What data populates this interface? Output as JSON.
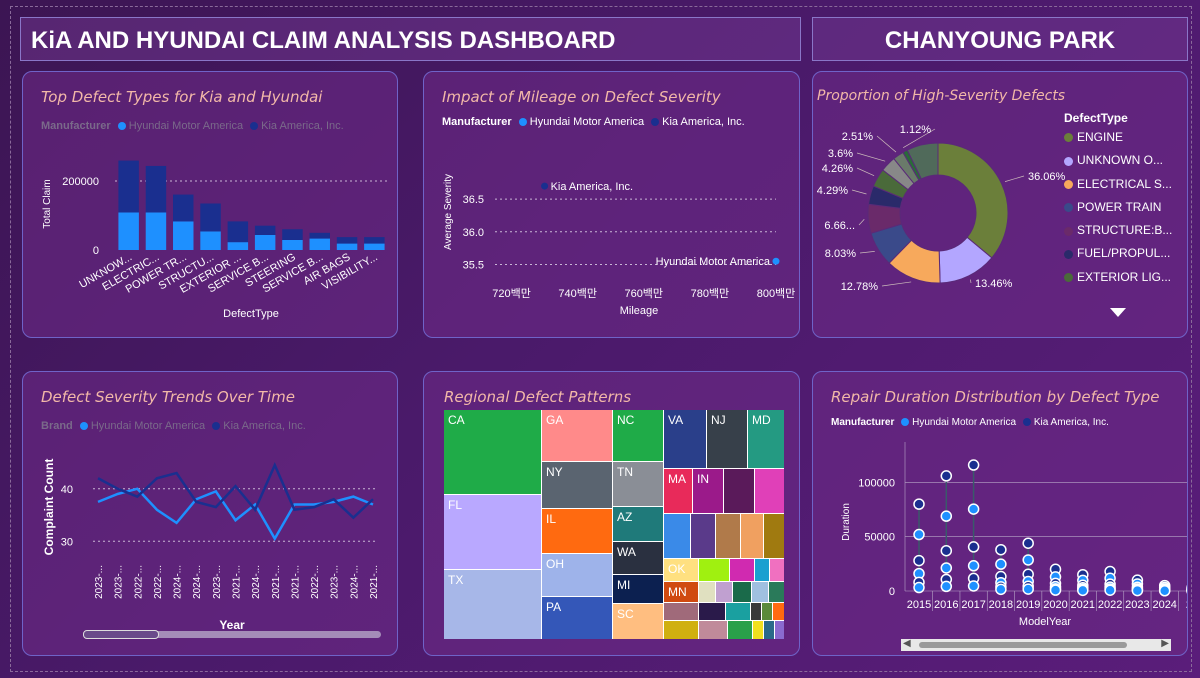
{
  "header": {
    "title": "KiA AND HYUNDAI CLAIM ANALYSIS DASHBOARD",
    "author": "CHANYOUNG PARK"
  },
  "colors": {
    "hyundai": "#1e90ff",
    "kia": "#1a2f8f",
    "title": "#f2b8a8"
  },
  "legend": {
    "manufacturer": "Manufacturer",
    "brand": "Brand",
    "hyundai": "Hyundai Motor America",
    "kia": "Kia America, Inc."
  },
  "charts": [
    {
      "id": "top-defect-types",
      "title": "Top Defect Types for Kia and Hyundai",
      "type": "bar",
      "xlabel": "DefectType",
      "ylabel": "Total Claim",
      "yticks": [
        "0",
        "200000"
      ],
      "categories": [
        "UNKNOW...",
        "ELECTRIC...",
        "POWER TR...",
        "STRUCTU...",
        "EXTERIOR ...",
        "SERVICE B...",
        "STEERING",
        "SERVICE B...",
        "AIR BAGS",
        "VISIBILITY..."
      ],
      "series": [
        {
          "name": "Hyundai Motor America",
          "values": [
            105000,
            105000,
            80000,
            52000,
            22000,
            42000,
            28000,
            32000,
            18000,
            18000
          ]
        },
        {
          "name": "Kia America, Inc.",
          "values": [
            145000,
            130000,
            75000,
            78000,
            58000,
            26000,
            30000,
            16000,
            18000,
            18000
          ]
        }
      ],
      "ylim": [
        0,
        260000
      ]
    },
    {
      "id": "mileage-severity",
      "title": "Impact of Mileage on Defect Severity",
      "type": "scatter",
      "xlabel": "Mileage",
      "ylabel": "Average Severity",
      "xticks": [
        "720백만",
        "740백만",
        "760백만",
        "780백만",
        "800백만"
      ],
      "yticks": [
        "35.5",
        "36.0",
        "36.5"
      ],
      "points": [
        {
          "name": "Kia America, Inc.",
          "x": 730,
          "y": 36.7
        },
        {
          "name": "Hyundai Motor America",
          "x": 800,
          "y": 35.55
        }
      ],
      "xlim": [
        715,
        800
      ],
      "ylim": [
        35.4,
        36.9
      ]
    },
    {
      "id": "high-severity-proportion",
      "title": "Proportion of High-Severity Defects",
      "type": "pie",
      "legend_title": "DefectType",
      "legend": [
        "ENGINE",
        "UNKNOWN O...",
        "ELECTRICAL S...",
        "POWER TRAIN",
        "STRUCTURE:B...",
        "FUEL/PROPUL...",
        "EXTERIOR LIG..."
      ],
      "slices": [
        {
          "label": "ENGINE",
          "value": 36.06,
          "text": "36.06%",
          "color": "#6b7f3a"
        },
        {
          "label": "UNKNOWN O...",
          "value": 13.46,
          "text": "13.46%",
          "color": "#b3a6ff"
        },
        {
          "label": "ELECTRICAL S...",
          "value": 12.78,
          "text": "12.78%",
          "color": "#f7a95c"
        },
        {
          "label": "POWER TRAIN",
          "value": 8.03,
          "text": "8.03%",
          "color": "#3a4a8a"
        },
        {
          "label": "STRUCTURE:B...",
          "value": 6.66,
          "text": "6.66...",
          "color": "#6a2a6a"
        },
        {
          "label": "FUEL/PROPUL...",
          "value": 4.29,
          "text": "4.29%",
          "color": "#2a2a6a"
        },
        {
          "label": "EXTERIOR LIG...",
          "value": 4.26,
          "text": "4.26%",
          "color": "#4a6a3a"
        },
        {
          "label": "",
          "value": 3.6,
          "text": "3.6%",
          "color": "#888888"
        },
        {
          "label": "",
          "value": 2.51,
          "text": "2.51%",
          "color": "#6a7a6a"
        },
        {
          "label": "",
          "value": 1.12,
          "text": "1.12%",
          "color": "#2a6a3a"
        },
        {
          "label": "",
          "value": 7.23,
          "text": "",
          "color": "#506a5a"
        }
      ]
    },
    {
      "id": "severity-trends",
      "title": "Defect Severity Trends Over Time",
      "type": "line",
      "xlabel": "Year",
      "ylabel": "Complaint Count",
      "yticks": [
        "30",
        "40"
      ],
      "categories": [
        "2023-...",
        "2023-...",
        "2022-...",
        "2022-...",
        "2024-...",
        "2024-...",
        "2023-...",
        "2021-...",
        "2024-...",
        "2021-...",
        "2021-...",
        "2022-...",
        "2023-...",
        "2024-...",
        "2021-..."
      ],
      "series": [
        {
          "name": "Hyundai Motor America",
          "values": [
            37.5,
            39,
            40,
            36,
            33.5,
            38,
            39.5,
            34,
            37,
            30.5,
            37,
            37,
            37.5,
            38.5,
            37
          ]
        },
        {
          "name": "Kia America, Inc.",
          "values": [
            42,
            40,
            38.5,
            42,
            43,
            37.5,
            36.5,
            40.5,
            36,
            44.5,
            36,
            36.5,
            38,
            34.5,
            38
          ]
        }
      ],
      "ylim": [
        27,
        47
      ]
    },
    {
      "id": "regional-patterns",
      "title": "Regional Defect Patterns",
      "type": "treemap",
      "cells": [
        "CA",
        "FL",
        "TX",
        "GA",
        "NY",
        "IL",
        "OH",
        "PA",
        "NC",
        "TN",
        "AZ",
        "WA",
        "MI",
        "SC",
        "VA",
        "NJ",
        "MD",
        "MA",
        "IN",
        "OK",
        "MN"
      ]
    },
    {
      "id": "repair-duration",
      "title": "Repair Duration Distribution by Defect Type",
      "type": "scatter",
      "xlabel": "ModelYear",
      "ylabel": "Duration",
      "yticks": [
        "0",
        "50000",
        "100000"
      ],
      "categories": [
        "2015",
        "2016",
        "2017",
        "2018",
        "2019",
        "2020",
        "2021",
        "2022",
        "2023",
        "2024",
        "20"
      ],
      "maxima": [
        80000,
        106000,
        116000,
        38000,
        44000,
        20000,
        15000,
        18000,
        10000,
        5000,
        3000
      ],
      "ylim": [
        0,
        128000
      ]
    }
  ],
  "chart_data": [
    {
      "type": "bar",
      "title": "Top Defect Types for Kia and Hyundai",
      "xlabel": "DefectType",
      "ylabel": "Total Claim"
    },
    {
      "type": "scatter",
      "title": "Impact of Mileage on Defect Severity",
      "xlabel": "Mileage",
      "ylabel": "Average Severity"
    },
    {
      "type": "pie",
      "title": "Proportion of High-Severity Defects"
    },
    {
      "type": "line",
      "title": "Defect Severity Trends Over Time",
      "xlabel": "Year",
      "ylabel": "Complaint Count"
    },
    {
      "type": "heatmap",
      "title": "Regional Defect Patterns"
    },
    {
      "type": "scatter",
      "title": "Repair Duration Distribution by Defect Type",
      "xlabel": "ModelYear",
      "ylabel": "Duration"
    }
  ]
}
